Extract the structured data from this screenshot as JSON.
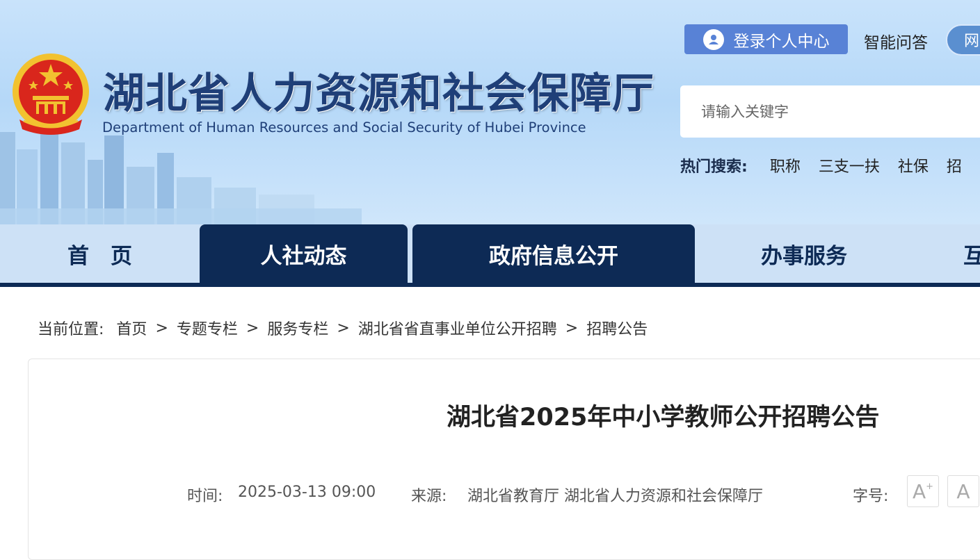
{
  "header": {
    "title": "湖北省人力资源和社会保障厅",
    "subtitle": "Department of Human Resources and Social Security of Hubei Province",
    "login_label": "登录个人中心",
    "qa_label": "智能问答",
    "pill_label": "网",
    "search_placeholder": "请输入关键字",
    "hot_search_label": "热门搜索:",
    "hot_search_items": [
      "职称",
      "三支一扶",
      "社保",
      "招"
    ]
  },
  "nav": {
    "items": [
      "首　页",
      "人社动态",
      "政府信息公开",
      "办事服务",
      "互"
    ],
    "active": [
      "人社动态",
      "政府信息公开"
    ]
  },
  "breadcrumb": {
    "label": "当前位置:",
    "items": [
      "首页",
      "专题专栏",
      "服务专栏",
      "湖北省省直事业单位公开招聘",
      "招聘公告"
    ],
    "separator": ">"
  },
  "article": {
    "title": "湖北省2025年中小学教师公开招聘公告",
    "time_label": "时间:",
    "time_value": "2025-03-13 09:00",
    "source_label": "来源:",
    "source_value": "湖北省教育厅 湖北省人力资源和社会保障厅",
    "font_size_label": "字号:",
    "font_larger": "A",
    "font_larger_sup": "+",
    "font_default": "A"
  },
  "colors": {
    "nav_dark": "#0d2a55",
    "title_blue": "#1f3f78",
    "login_blue": "#5882d6",
    "emblem_red": "#d9261c",
    "emblem_gold": "#f2c230"
  },
  "icons": [
    "user-icon",
    "national-emblem-icon"
  ]
}
